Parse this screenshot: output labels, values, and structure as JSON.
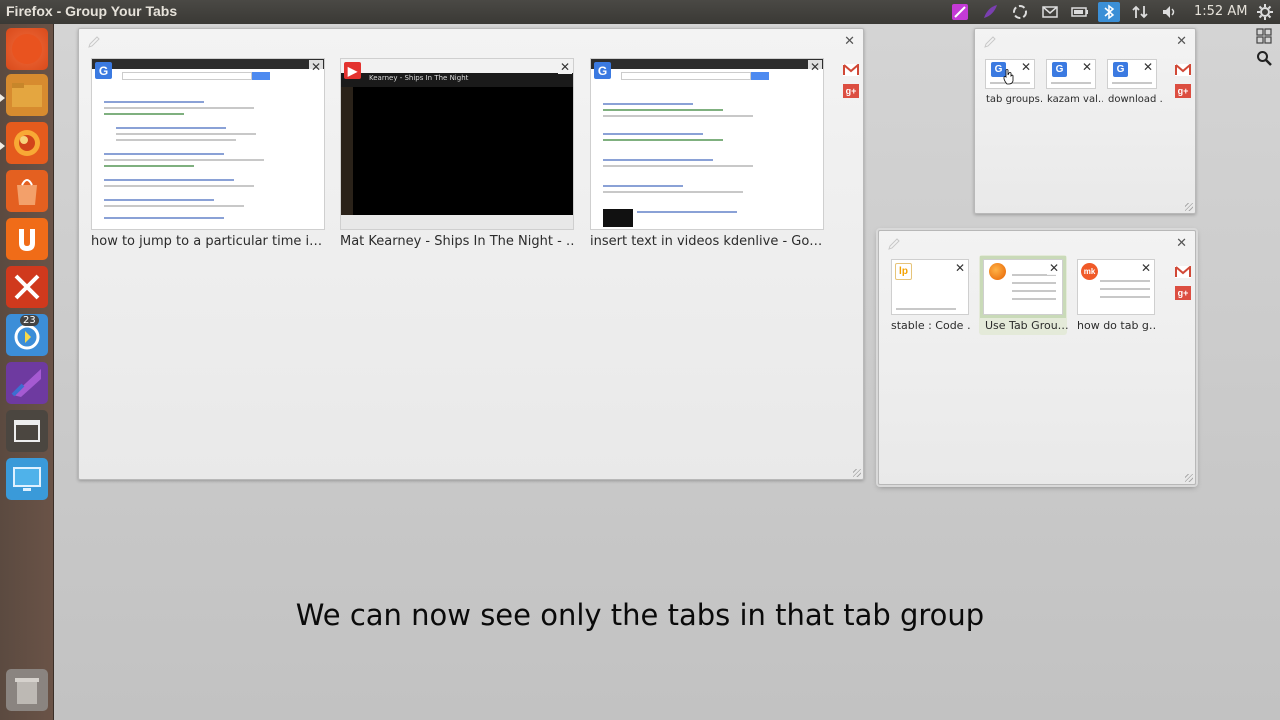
{
  "window": {
    "title": "Firefox - Group Your Tabs"
  },
  "panel": {
    "clock": "1:52 AM",
    "indicators": [
      "color-picker-icon",
      "feather-icon",
      "sync-icon",
      "mail-icon",
      "battery-icon",
      "bluetooth-icon",
      "network-icon",
      "volume-icon",
      "gear-icon"
    ]
  },
  "launcher": {
    "items": [
      "dash-home",
      "files",
      "firefox",
      "software-center",
      "ubuntu-one",
      "system-settings",
      "update-manager",
      "inkscape",
      "workspace-switcher",
      "screenshot",
      "trash"
    ],
    "update_badge": "23"
  },
  "groups": [
    {
      "id": "group-1",
      "tabs": [
        {
          "label": "how to jump to a particular time i…",
          "favicon": "G"
        },
        {
          "label": "Mat Kearney - Ships In The Night - …",
          "favicon": "▶",
          "thumb_text": "Kearney - Ships In The Night"
        },
        {
          "label": "insert text in videos kdenlive - Go…",
          "favicon": "G"
        }
      ]
    },
    {
      "id": "group-2",
      "tabs": [
        {
          "label": "tab groups…",
          "favicon": "G"
        },
        {
          "label": "kazam val…",
          "favicon": "G"
        },
        {
          "label": "download …",
          "favicon": "G"
        }
      ]
    },
    {
      "id": "group-3",
      "tabs": [
        {
          "label": "stable : Code …",
          "favicon": "lp"
        },
        {
          "label": "Use Tab Grou…",
          "favicon": ""
        },
        {
          "label": "how do tab g…",
          "favicon": "mk"
        }
      ]
    }
  ],
  "app_tabs": {
    "gplus_label": "g+"
  },
  "subtitle": "We can now see only the tabs in that tab group"
}
